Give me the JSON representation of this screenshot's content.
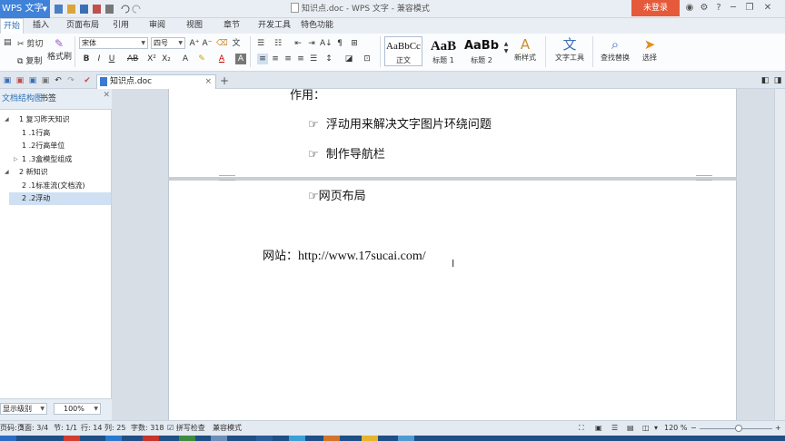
{
  "app": {
    "button_label": "WPS 文字",
    "window_title": "知识点.doc - WPS 文字 - 兼容模式",
    "login_label": "未登录"
  },
  "menu": {
    "tabs": [
      "开始",
      "插入",
      "页面布局",
      "引用",
      "审阅",
      "视图",
      "章节",
      "开发工具",
      "特色功能"
    ],
    "active_tab": "开始"
  },
  "ribbon": {
    "cut": "剪切",
    "copy": "复制",
    "format_painter": "格式刷",
    "font_name": "宋体",
    "font_size": "四号",
    "styles": [
      {
        "sample": "AaBbCc",
        "label": "正文"
      },
      {
        "sample": "AaB",
        "label": "标题 1"
      },
      {
        "sample": "AaBb",
        "label": "标题 2"
      }
    ],
    "new_style": "新样式",
    "text_tools": "文字工具",
    "find_replace": "查找替换",
    "select": "选择"
  },
  "document_tab": {
    "name": "知识点.doc"
  },
  "nav_pane": {
    "tab_structure": "文档结构图",
    "tab_bookmark": "书签",
    "items": [
      {
        "label": "1 复习昨天知识",
        "level": 0,
        "toggle": "◢"
      },
      {
        "label": "1 .1行高",
        "level": 1,
        "toggle": ""
      },
      {
        "label": "1 .2行高单位",
        "level": 1,
        "toggle": ""
      },
      {
        "label": "1 .3盒模型组成",
        "level": 1,
        "toggle": "▷"
      },
      {
        "label": "2 新知识",
        "level": 0,
        "toggle": "◢"
      },
      {
        "label": "2 .1标准流(文档流)",
        "level": 1,
        "toggle": ""
      },
      {
        "label": "2 .2浮动",
        "level": 1,
        "toggle": ""
      }
    ],
    "selected_index": 6,
    "display_level": "显示级别",
    "zoom": "100%"
  },
  "document": {
    "heading": "作用：",
    "bullet_glyph": "☞",
    "bullets": [
      "浮动用来解决文字图片环绕问题",
      "制作导航栏"
    ],
    "page2_bullet": "☞网页布局",
    "website_label": "网站：",
    "website_url": "http://www.17sucai.com/"
  },
  "status": {
    "page": "页码: 3",
    "pages": "页面: 3/4",
    "section": "节: 1/1",
    "row": "行: 14",
    "col": "列: 25",
    "words": "字数: 318",
    "spell": "拼写检查",
    "compat": "兼容模式",
    "zoom": "120 %",
    "zoom_level": 0.54
  },
  "colors": {
    "accent": "#3f82d8",
    "login": "#e45a3b",
    "taskbar": "#1e4f86"
  }
}
